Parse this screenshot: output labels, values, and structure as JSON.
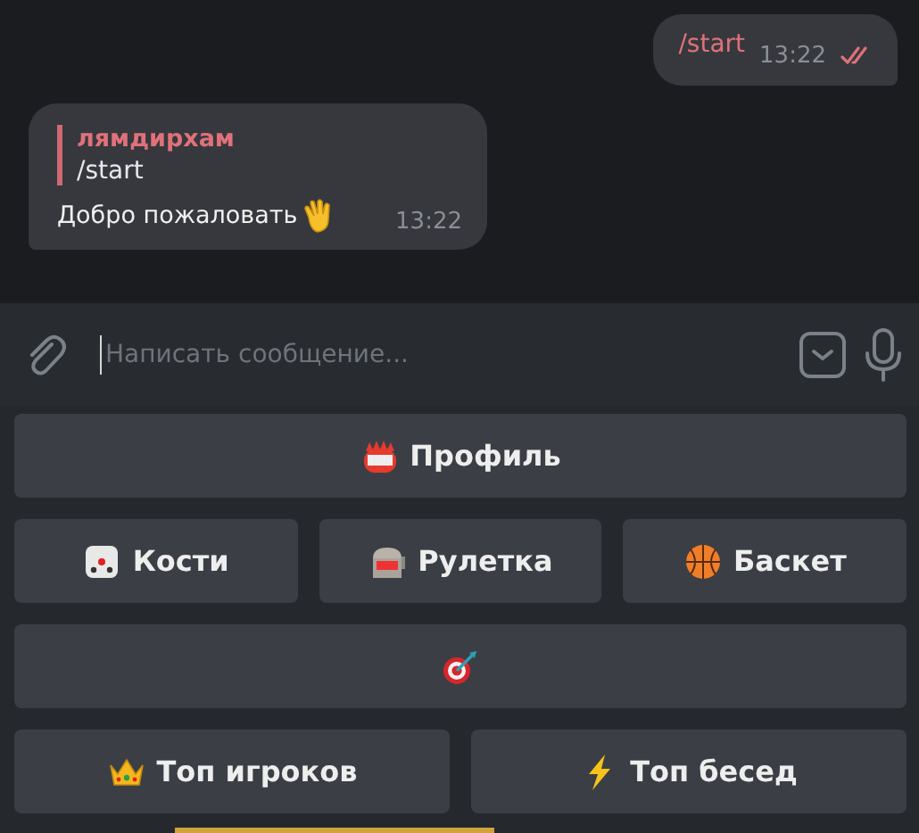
{
  "messages": [
    {
      "kind": "outgoing",
      "text": "/start",
      "time": "13:22",
      "read": true
    },
    {
      "kind": "incoming",
      "reply": {
        "author": "лямдирхам",
        "text": "/start"
      },
      "text": "Добро пожаловать",
      "time": "13:22"
    }
  ],
  "composer": {
    "placeholder": "Написать сообщение..."
  },
  "keyboard": [
    [
      {
        "kind": "labeled",
        "label": "Профиль"
      }
    ],
    [
      {
        "kind": "labeled",
        "label": "Кости"
      },
      {
        "kind": "labeled",
        "label": "Рулетка"
      },
      {
        "kind": "labeled",
        "label": "Баскет"
      }
    ],
    [
      {
        "kind": "icon_only"
      }
    ],
    [
      {
        "kind": "labeled",
        "label": "Топ игроков"
      },
      {
        "kind": "labeled",
        "label": "Топ бесед"
      }
    ]
  ]
}
